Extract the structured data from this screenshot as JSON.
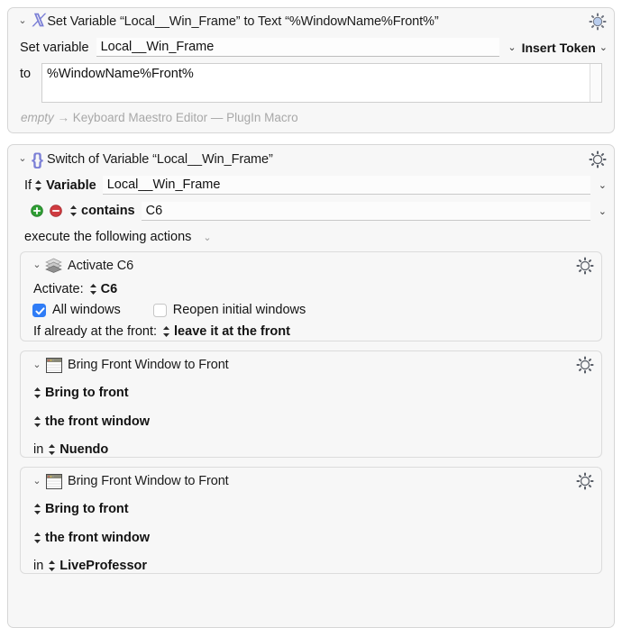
{
  "app": {
    "name": "Keyboard Maestro Editor",
    "accent_blue": "#2f7cf6",
    "icon_purple": "#7b7fd6",
    "add_green": "#3aa93a",
    "remove_red": "#d0393e"
  },
  "actions": [
    {
      "id": "set-variable",
      "icon": "variable-x-icon",
      "title": "Set Variable “Local__Win_Frame” to Text “%WindowName%Front%”",
      "gear_label": "gear-icon",
      "disclosure": "⌄",
      "rows": {
        "set_variable_label": "Set variable",
        "variable_name": "Local__Win_Frame",
        "variable_chevron": "⌄",
        "insert_token_label": "Insert Token",
        "insert_token_chevron": "⌄",
        "to_label": "to",
        "to_value": "%WindowName%Front%"
      },
      "status": {
        "empty_label": "empty",
        "arrow": "→",
        "target": "Keyboard Maestro Editor — PlugIn Macro"
      }
    },
    {
      "id": "switch-of-variable",
      "icon": "braces-icon",
      "title": "Switch of Variable “Local__Win_Frame”",
      "disclosure": "⌄",
      "if_row": {
        "if_label": "If",
        "source_label": "Variable",
        "value": "Local__Win_Frame",
        "chevron": "⌄"
      },
      "condition_row": {
        "add_label": "+",
        "remove_label": "−",
        "operator": "contains",
        "value": "C6",
        "chevron": "⌄"
      },
      "execute_row": {
        "label": "execute the following actions",
        "chevron": "⌄"
      },
      "children": [
        {
          "id": "activate-c6",
          "icon": "activate-app-icon",
          "title": "Activate C6",
          "disclosure": "⌄",
          "activate_label": "Activate:",
          "activate_target": "C6",
          "checkbox_all_windows": {
            "label": "All windows",
            "checked": true
          },
          "checkbox_reopen": {
            "label": "Reopen initial windows",
            "checked": false
          },
          "front_label": "If already at the front:",
          "front_value": "leave it at the front"
        },
        {
          "id": "bring-front-window-nuendo",
          "icon": "window-icon",
          "title": "Bring Front Window to Front",
          "disclosure": "⌄",
          "line1": "Bring to front",
          "line2": "the front window",
          "in_label": "in",
          "in_value": "Nuendo"
        },
        {
          "id": "bring-front-window-liveprofessor",
          "icon": "window-icon",
          "title": "Bring Front Window to Front",
          "disclosure": "⌄",
          "line1": "Bring to front",
          "line2": "the front window",
          "in_label": "in",
          "in_value": "LiveProfessor"
        }
      ]
    }
  ]
}
